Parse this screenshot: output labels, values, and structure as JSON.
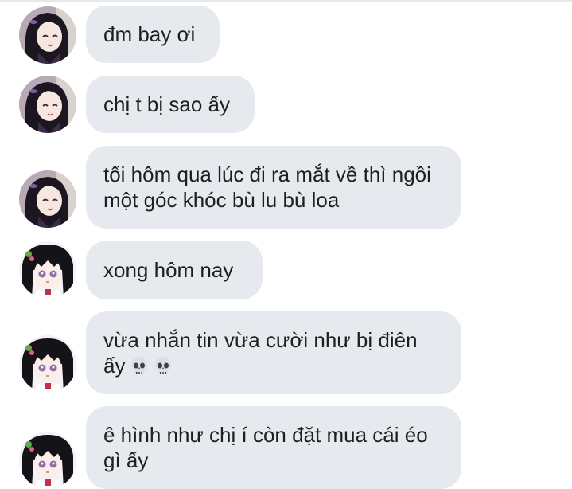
{
  "conversation": {
    "messages": [
      {
        "sender": "shinobu",
        "text": "đm bay ơi"
      },
      {
        "sender": "shinobu",
        "text": "chị t bị sao ấy"
      },
      {
        "sender": "shinobu",
        "text": "tối hôm qua lúc đi ra mắt về thì ngồi một góc khóc bù lu bù loa"
      },
      {
        "sender": "kanao",
        "text": "xong hôm nay"
      },
      {
        "sender": "kanao",
        "text": "vừa nhắn tin vừa cười như bị điên ấy",
        "emojis": [
          "skull-icon",
          "skull-icon"
        ]
      },
      {
        "sender": "kanao",
        "text": "ê hình như chị í còn đặt mua cái éo gì ấy"
      }
    ]
  },
  "colors": {
    "bubble_background": "#e6eaef",
    "text": "#1d1f22",
    "page_background": "#ffffff"
  }
}
